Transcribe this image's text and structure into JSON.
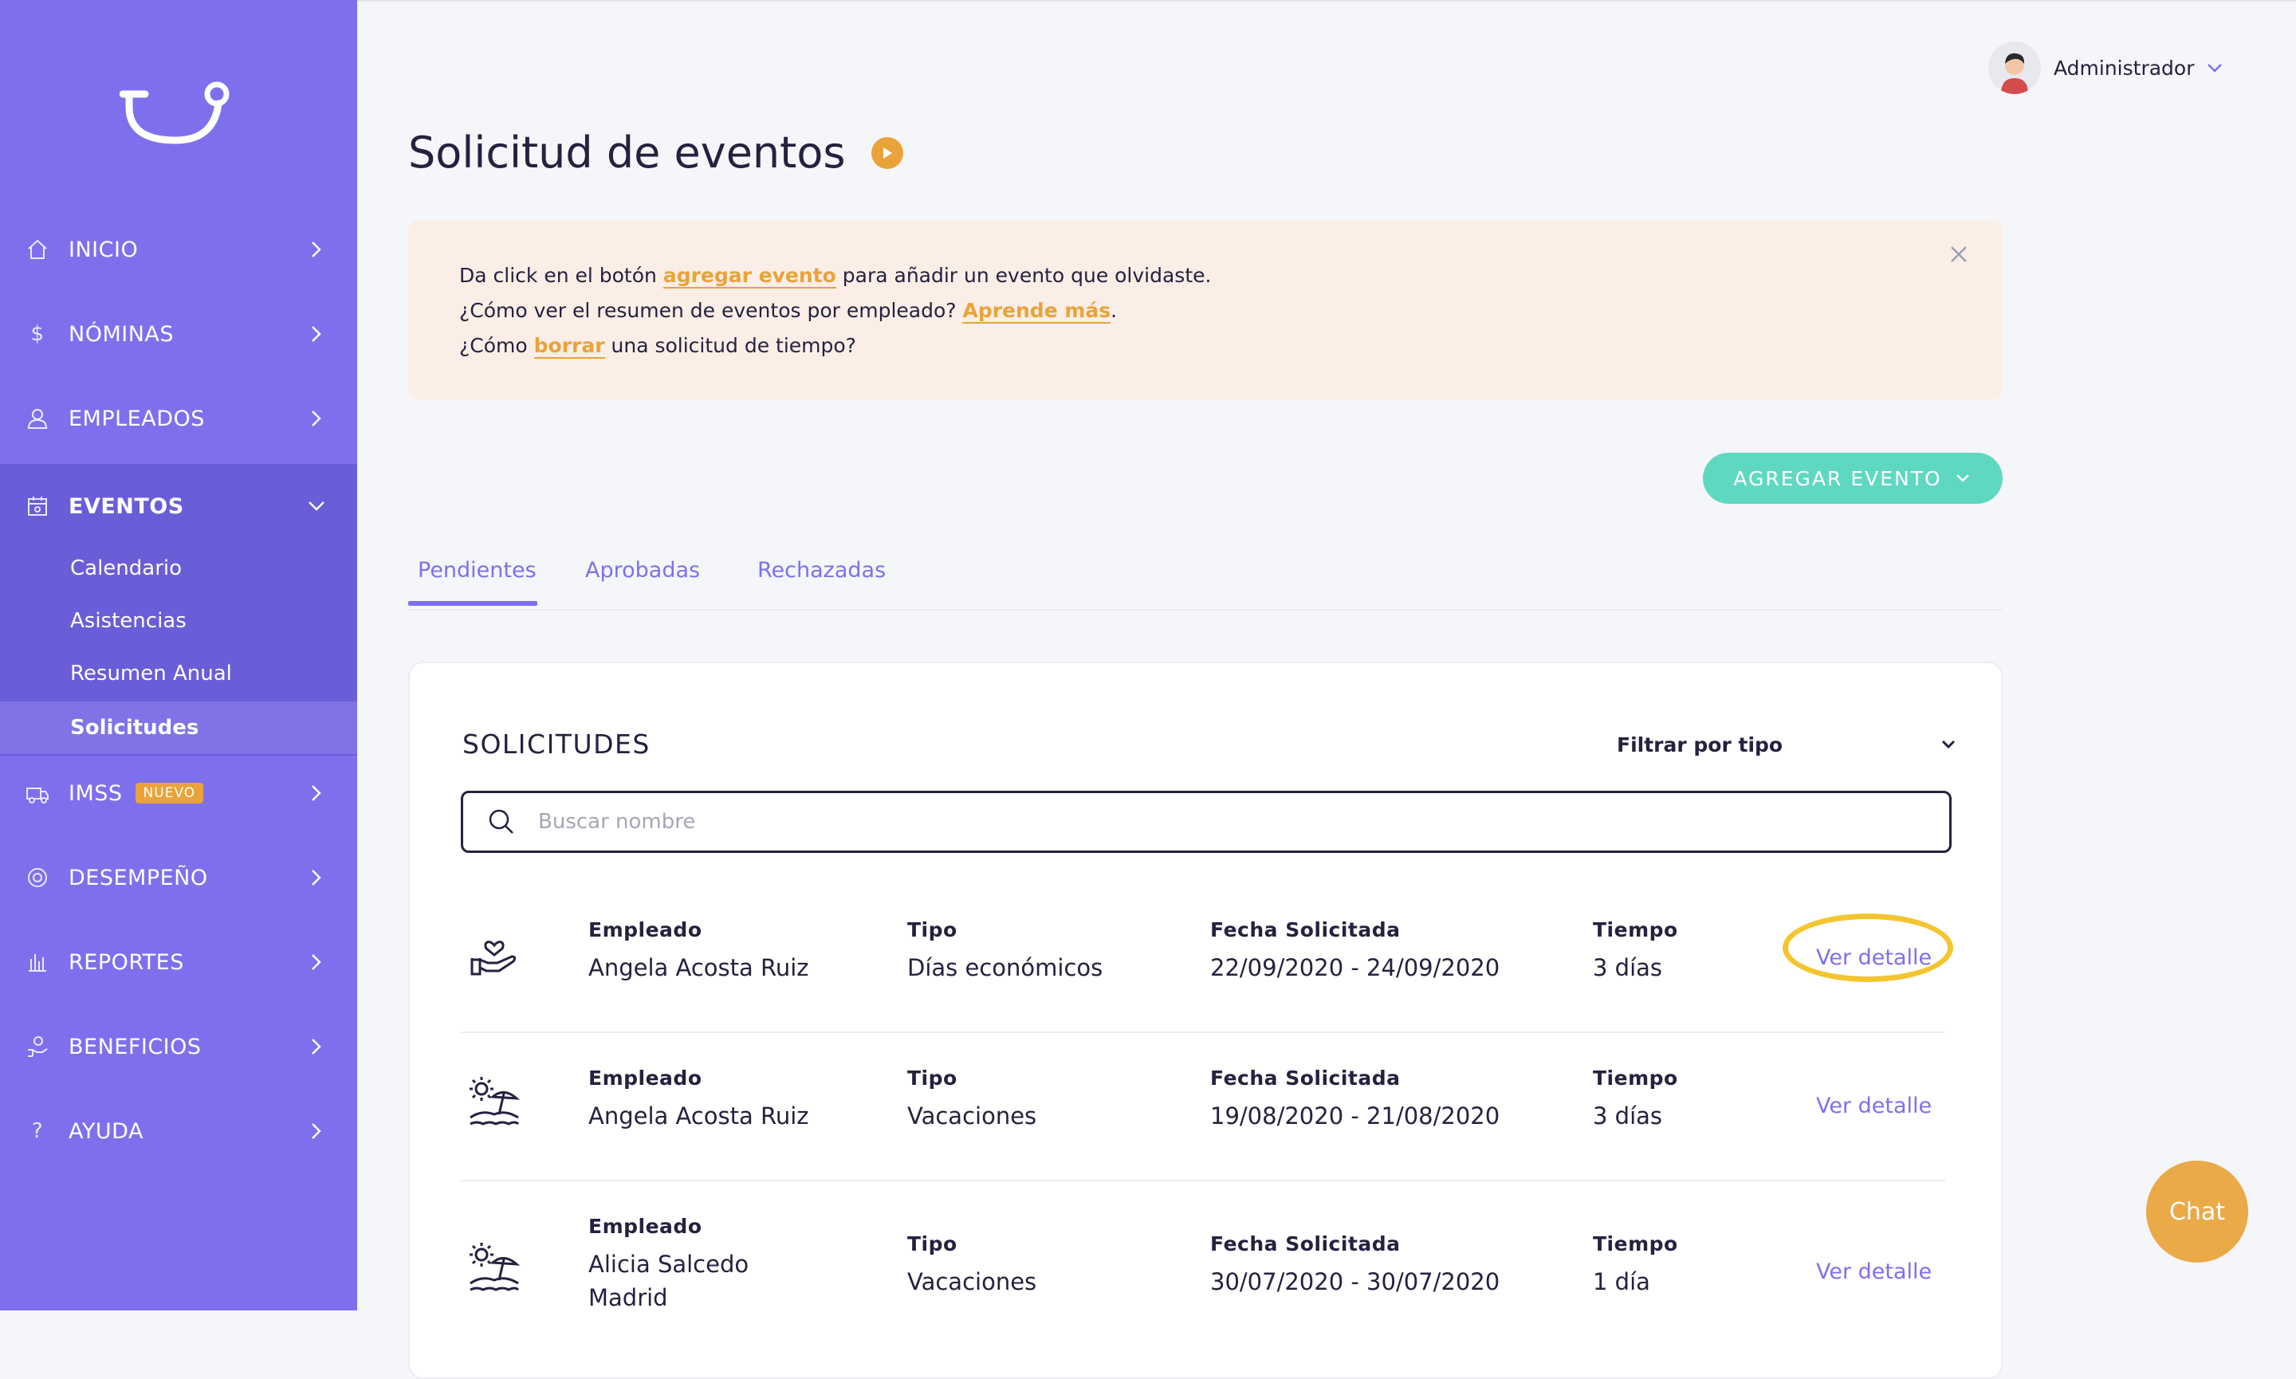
{
  "user": {
    "name": "Administrador"
  },
  "sidebar": {
    "items": [
      {
        "label": "INICIO",
        "icon": "home-icon"
      },
      {
        "label": "NÓMINAS",
        "icon": "dollar-icon"
      },
      {
        "label": "EMPLEADOS",
        "icon": "user-icon"
      },
      {
        "label": "EVENTOS",
        "icon": "calendar-icon"
      },
      {
        "label": "IMSS",
        "icon": "ambulance-icon",
        "badge": "NUEVO"
      },
      {
        "label": "DESEMPEÑO",
        "icon": "target-icon"
      },
      {
        "label": "REPORTES",
        "icon": "bar-chart-icon"
      },
      {
        "label": "BENEFICIOS",
        "icon": "hand-coin-icon"
      },
      {
        "label": "AYUDA",
        "icon": "question-icon"
      }
    ],
    "submenu": [
      "Calendario",
      "Asistencias",
      "Resumen Anual",
      "Solicitudes"
    ]
  },
  "page": {
    "title": "Solicitud de eventos"
  },
  "info": {
    "line1_pre": "Da click en el botón ",
    "line1_link": "agregar evento",
    "line1_post": " para añadir un evento que olvidaste.",
    "line2_pre": "¿Cómo ver el resumen de eventos por empleado? ",
    "line2_link": "Aprende más",
    "line2_post": ".",
    "line3_pre": "¿Cómo ",
    "line3_link": "borrar",
    "line3_post": " una solicitud de tiempo?"
  },
  "add_button": {
    "label": "AGREGAR EVENTO"
  },
  "tabs": [
    "Pendientes",
    "Aprobadas",
    "Rechazadas"
  ],
  "card": {
    "title": "SOLICITUDES",
    "filter_label": "Filtrar por tipo",
    "search_placeholder": "Buscar nombre"
  },
  "columns": {
    "employee": "Empleado",
    "type": "Tipo",
    "date": "Fecha Solicitada",
    "time": "Tiempo"
  },
  "rows": [
    {
      "icon": "heart-hand-icon",
      "employee": "Angela Acosta Ruiz",
      "type": "Días económicos",
      "date": "22/09/2020 - 24/09/2020",
      "time": "3 días",
      "action": "Ver detalle"
    },
    {
      "icon": "beach-icon",
      "employee": "Angela Acosta Ruiz",
      "type": "Vacaciones",
      "date": "19/08/2020 - 21/08/2020",
      "time": "3 días",
      "action": "Ver detalle"
    },
    {
      "icon": "beach-icon",
      "employee": "Alicia Salcedo Madrid",
      "type": "Vacaciones",
      "date": "30/07/2020 - 30/07/2020",
      "time": "1 día",
      "action": "Ver detalle"
    }
  ],
  "chat": {
    "label": "Chat"
  },
  "colors": {
    "sidebar": "#7e70ec",
    "accent": "#7e70ec",
    "orange": "#eaa33a",
    "teal": "#5fd8c2",
    "highlight": "#f3c52f"
  }
}
